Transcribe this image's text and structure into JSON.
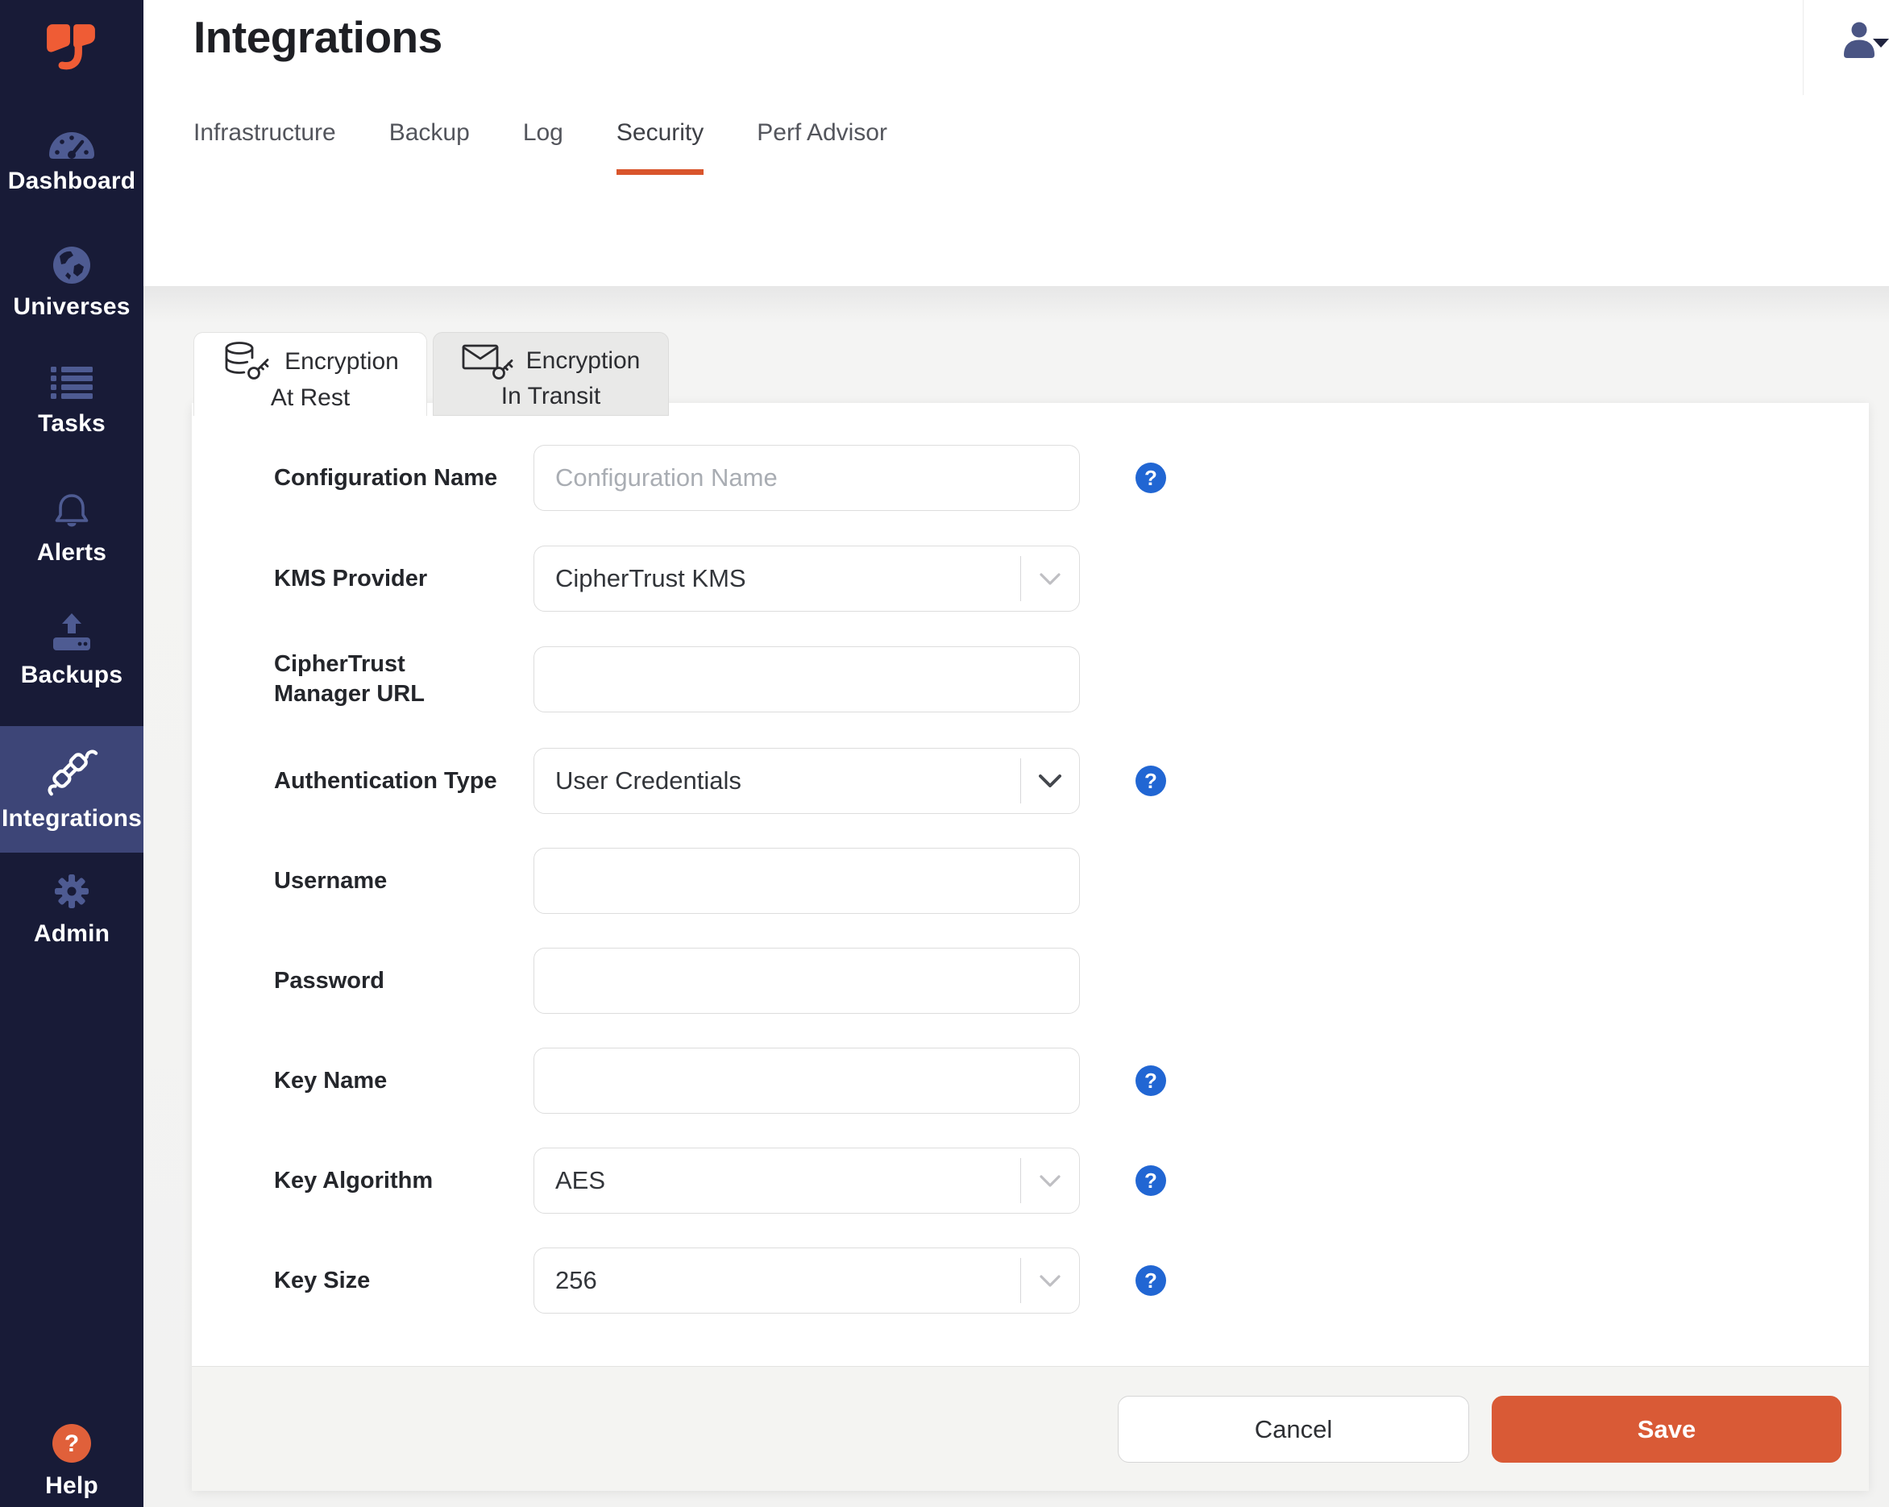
{
  "sidebar": {
    "items": [
      {
        "label": "Dashboard",
        "icon": "gauge-icon",
        "active": false
      },
      {
        "label": "Universes",
        "icon": "globe-icon",
        "active": false
      },
      {
        "label": "Tasks",
        "icon": "task-list-icon",
        "active": false
      },
      {
        "label": "Alerts",
        "icon": "bell-icon",
        "active": false
      },
      {
        "label": "Backups",
        "icon": "backup-upload-icon",
        "active": false
      },
      {
        "label": "Integrations",
        "icon": "plug-icon",
        "active": true
      },
      {
        "label": "Admin",
        "icon": "gear-icon",
        "active": false
      }
    ],
    "help": {
      "label": "Help",
      "icon": "help-question-icon"
    }
  },
  "header": {
    "title": "Integrations",
    "tabs": [
      {
        "label": "Infrastructure",
        "active": false
      },
      {
        "label": "Backup",
        "active": false
      },
      {
        "label": "Log",
        "active": false
      },
      {
        "label": "Security",
        "active": true
      },
      {
        "label": "Perf Advisor",
        "active": false
      }
    ]
  },
  "panel": {
    "tabs": [
      {
        "line1": "Encryption",
        "line2": "At Rest",
        "icon": "database-key-icon",
        "active": true
      },
      {
        "line1": "Encryption",
        "line2": "In Transit",
        "icon": "envelope-key-icon",
        "active": false
      }
    ]
  },
  "form": {
    "fields": [
      {
        "label": "Configuration Name",
        "type": "text",
        "value": "",
        "placeholder": "Configuration Name",
        "help": true
      },
      {
        "label": "KMS Provider",
        "type": "select",
        "value": "CipherTrust KMS",
        "placeholder": "",
        "help": false
      },
      {
        "label": "CipherTrust Manager URL",
        "type": "text",
        "value": "",
        "placeholder": "",
        "help": false
      },
      {
        "label": "Authentication Type",
        "type": "select",
        "value": "User Credentials",
        "placeholder": "",
        "help": true
      },
      {
        "label": "Username",
        "type": "text",
        "value": "",
        "placeholder": "",
        "help": false
      },
      {
        "label": "Password",
        "type": "password",
        "value": "",
        "placeholder": "",
        "help": false
      },
      {
        "label": "Key Name",
        "type": "text",
        "value": "",
        "placeholder": "",
        "help": true
      },
      {
        "label": "Key Algorithm",
        "type": "select",
        "value": "AES",
        "placeholder": "",
        "help": true
      },
      {
        "label": "Key Size",
        "type": "select",
        "value": "256",
        "placeholder": "",
        "help": true
      }
    ]
  },
  "footer": {
    "cancel_label": "Cancel",
    "save_label": "Save"
  },
  "colors": {
    "accent_orange": "#d9552c",
    "save_orange": "#d95a36",
    "logo_orange": "#ef5c35",
    "sidebar_bg": "#181b37",
    "sidebar_active": "#3d4577",
    "sidebar_icon": "#4e5b92",
    "help_blue": "#2166d3"
  }
}
